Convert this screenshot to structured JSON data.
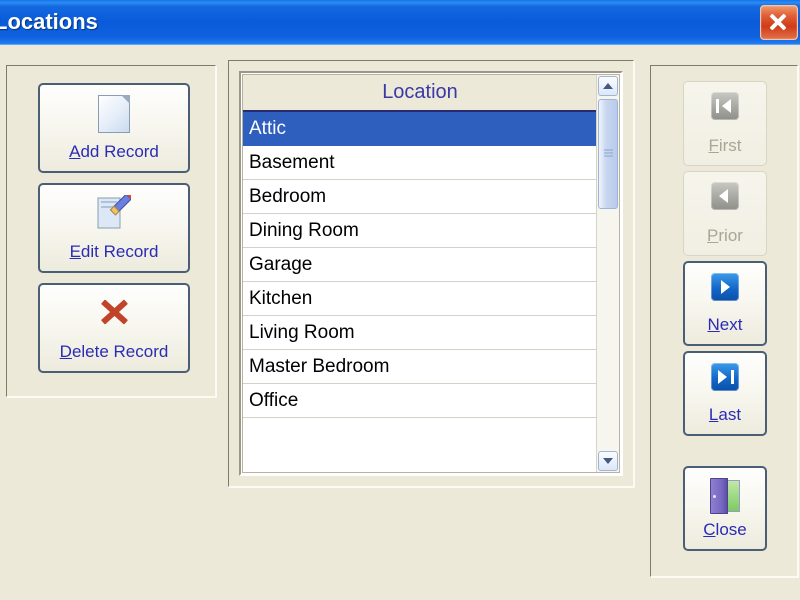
{
  "window": {
    "title": "Locations",
    "close_icon": "close-x-icon"
  },
  "actions": {
    "add": {
      "accel": "A",
      "rest": "dd Record",
      "icon": "new-page-icon"
    },
    "edit": {
      "accel": "E",
      "rest": "dit Record",
      "icon": "pencil-page-icon"
    },
    "delete": {
      "accel": "D",
      "rest": "elete Record",
      "icon": "red-x-icon"
    }
  },
  "navigation": {
    "first": {
      "accel": "F",
      "rest": "irst",
      "icon": "first-record-icon",
      "enabled": false
    },
    "prior": {
      "accel": "P",
      "rest": "rior",
      "icon": "prior-record-icon",
      "enabled": false
    },
    "next": {
      "accel": "N",
      "rest": "ext",
      "icon": "next-record-icon",
      "enabled": true
    },
    "last": {
      "accel": "L",
      "rest": "ast",
      "icon": "last-record-icon",
      "enabled": true
    },
    "close": {
      "accel": "C",
      "rest": "lose",
      "icon": "exit-door-icon",
      "enabled": true
    }
  },
  "list": {
    "header": "Location",
    "selected_index": 0,
    "rows": [
      "Attic",
      "Basement",
      "Bedroom",
      "Dining Room",
      "Garage",
      "Kitchen",
      "Living Room",
      "Master Bedroom",
      "Office"
    ]
  },
  "colors": {
    "titlebar_blue": "#0A5BDA",
    "window_face": "#ECE9D8",
    "selection_blue": "#2E5FBE",
    "header_text_blue": "#3A39A8",
    "button_text_blue": "#2B2BB5",
    "disabled_text": "#A9A694",
    "close_button_red": "#CE3B17"
  }
}
